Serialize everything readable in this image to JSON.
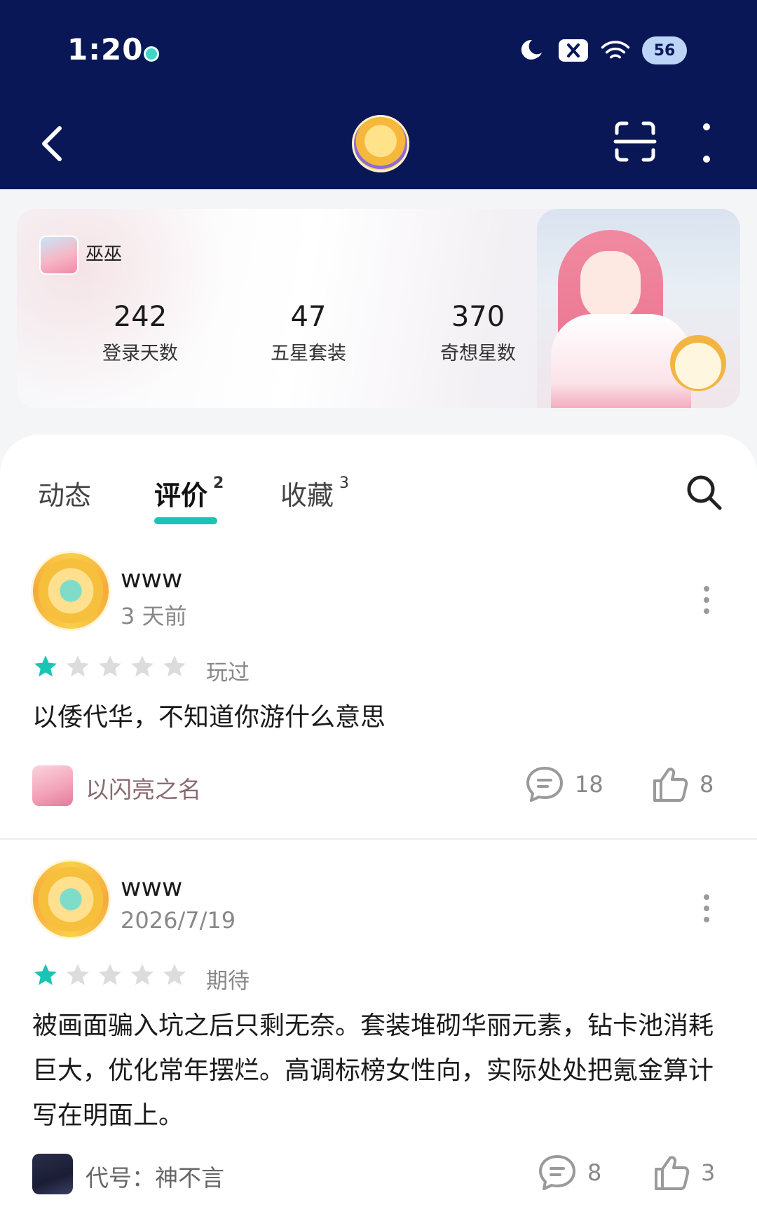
{
  "status_bar": {
    "time": "1:20",
    "battery": "56"
  },
  "profile": {
    "game_name": "巫巫",
    "stats": [
      {
        "value": "242",
        "label": "登录天数"
      },
      {
        "value": "47",
        "label": "五星套装"
      },
      {
        "value": "370",
        "label": "奇想星数"
      }
    ]
  },
  "tabs": [
    {
      "label": "动态",
      "count": ""
    },
    {
      "label": "评价",
      "count": "2"
    },
    {
      "label": "收藏",
      "count": "3"
    }
  ],
  "reviews": [
    {
      "username": "www",
      "time": "3 天前",
      "rating": 1,
      "max_rating": 5,
      "status": "玩过",
      "text": "以倭代华，不知道你游什么意思",
      "game": "以闪亮之名",
      "comments": "18",
      "likes": "8"
    },
    {
      "username": "www",
      "time": "2026/7/19",
      "rating": 1,
      "max_rating": 5,
      "status": "期待",
      "text": "被画面骗入坑之后只剩无奈。套装堆砌华丽元素，钻卡池消耗巨大，优化常年摆烂。高调标榜女性向，实际处处把氪金算计写在明面上。",
      "game": "代号：神不言",
      "comments": "8",
      "likes": "3"
    }
  ],
  "colors": {
    "header_bg": "#0a1756",
    "accent": "#19c4b5",
    "star_filled": "#19c4b5",
    "star_empty": "#dcdcdc"
  }
}
